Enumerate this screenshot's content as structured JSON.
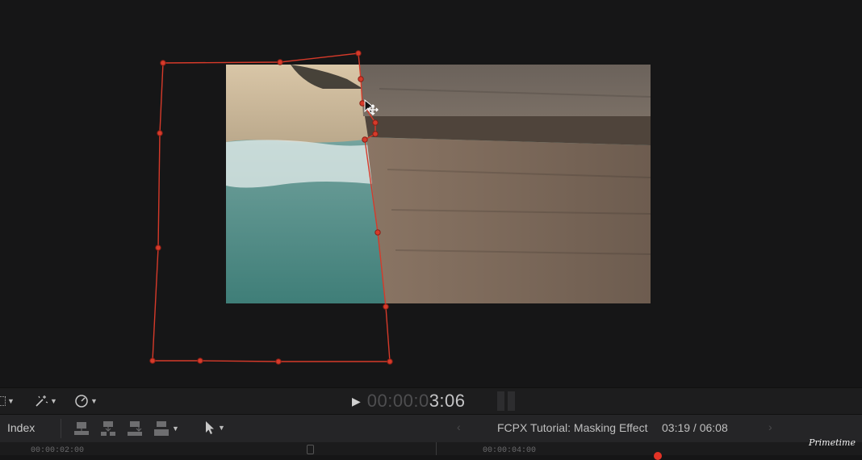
{
  "colors": {
    "accent": "#e13a2a",
    "viewer_bg": "#161617",
    "sand": "#cbb89b",
    "water": "#4e8a85",
    "wall": "#7a6a5d"
  },
  "transport": {
    "play_icon": "play-icon",
    "timecode_dim": "00:00:0",
    "timecode_bright": "3:06"
  },
  "timeline_toolbar": {
    "index_label": "Index",
    "project_title": "FCPX Tutorial: Masking Effect",
    "project_time": "03:19 / 06:08"
  },
  "ruler": {
    "labels": [
      "00:00:02:00",
      "00:00:04:00"
    ]
  },
  "watermark": "Primetime"
}
